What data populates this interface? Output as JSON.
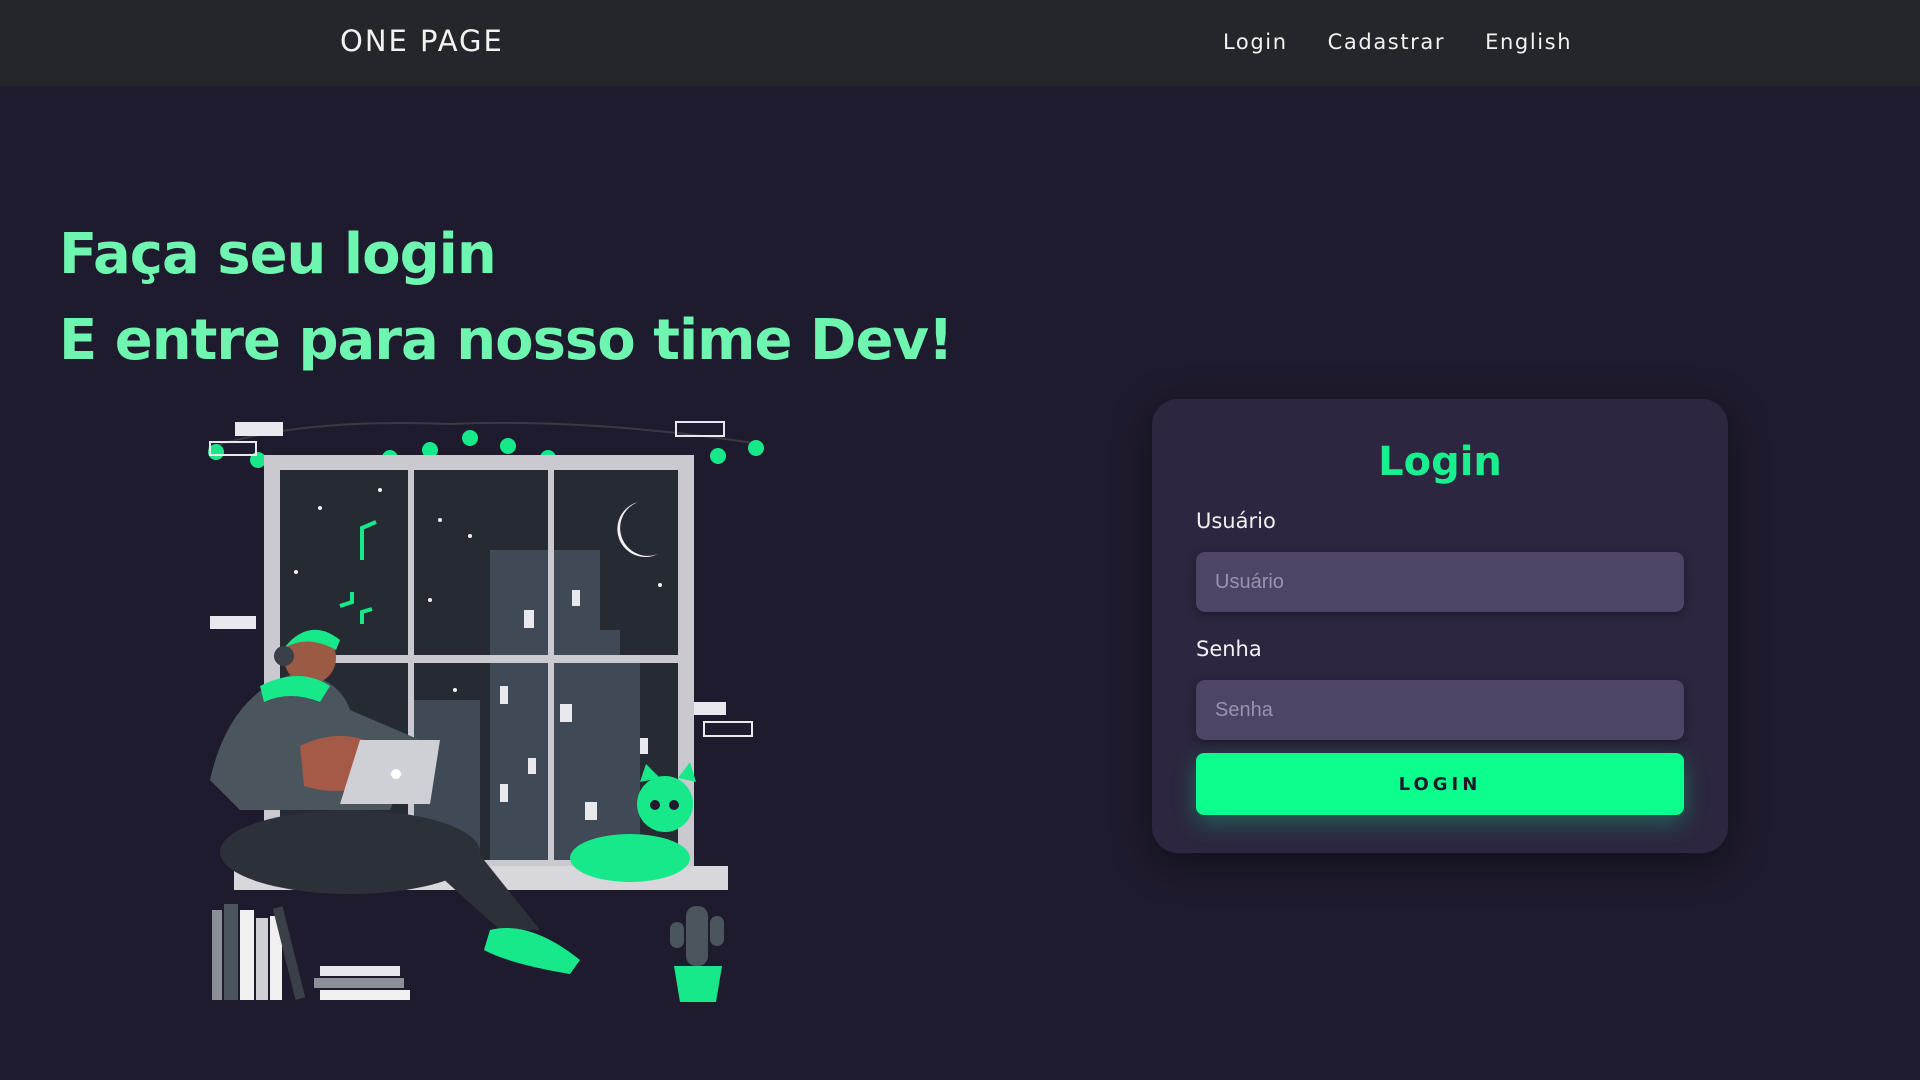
{
  "header": {
    "brand": "ONE PAGE",
    "nav": [
      "Login",
      "Cadastrar",
      "English"
    ]
  },
  "hero": {
    "line1": "Faça seu login",
    "line2": "E entre para nosso time Dev!"
  },
  "login_card": {
    "title": "Login",
    "username_label": "Usuário",
    "username_placeholder": "Usuário",
    "password_label": "Senha",
    "password_placeholder": "Senha",
    "submit_label": "LOGIN"
  },
  "colors": {
    "background": "#1f1b2e",
    "topbar": "#25252c",
    "accent": "#0bff8c",
    "headline": "#6ef5b0",
    "card": "#2c2640",
    "input": "#4d4466"
  }
}
